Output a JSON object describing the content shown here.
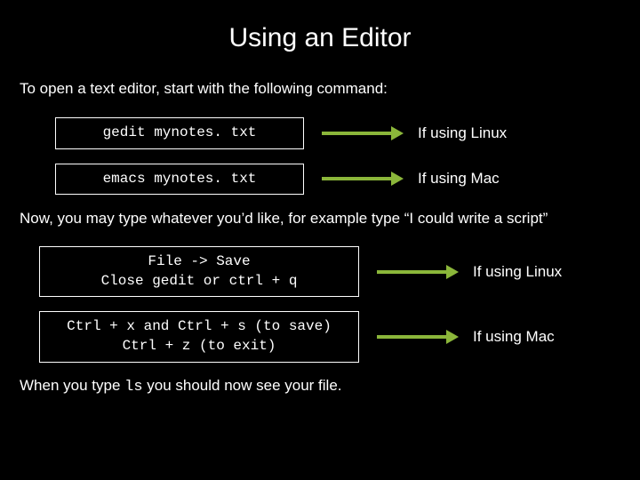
{
  "title": "Using an Editor",
  "intro": "To open a text editor, start with the following command:",
  "openCommands": [
    {
      "cmd": "gedit mynotes. txt",
      "label": "If using Linux"
    },
    {
      "cmd": "emacs mynotes. txt",
      "label": "If using Mac"
    }
  ],
  "midPara": "Now, you may type whatever you’d like, for example type “I could write a script”",
  "saveCommands": [
    {
      "cmd": "File -> Save\nClose gedit or ctrl + q",
      "label": "If using Linux"
    },
    {
      "cmd": "Ctrl + x and Ctrl + s (to save)\nCtrl + z (to exit)",
      "label": "If using Mac"
    }
  ],
  "closing": {
    "pre": "When you type ",
    "code": "ls",
    "post": " you should now see your file."
  },
  "colors": {
    "arrow": "#8bb63a"
  }
}
